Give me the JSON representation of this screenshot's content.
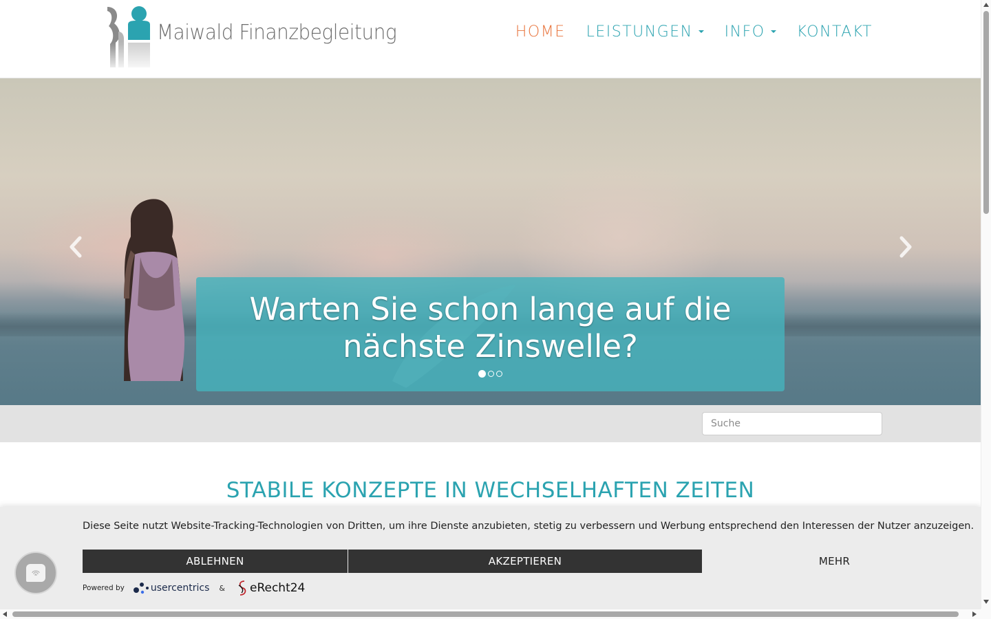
{
  "header": {
    "logo_text": "Maiwald Finanzbegleitung",
    "nav": [
      {
        "label": "HOME",
        "active": true
      },
      {
        "label": "LEISTUNGEN",
        "dropdown": true
      },
      {
        "label": "INFO",
        "dropdown": true
      },
      {
        "label": "KONTAKT"
      }
    ]
  },
  "hero": {
    "caption_line1": "Warten Sie schon lange auf die",
    "caption_line2": "nächste Zinswelle?",
    "slides_total": 3,
    "active_slide": 1,
    "prev_icon": "chevron-left-icon",
    "next_icon": "chevron-right-icon"
  },
  "search": {
    "placeholder": "Suche"
  },
  "main": {
    "headline": "STABILE KONZEPTE IN WECHSELHAFTEN ZEITEN"
  },
  "cookie_banner": {
    "text": "Diese Seite nutzt Website-Tracking-Technologien von Dritten, um ihre Dienste anzubieten, stetig zu verbessern und Werbung entsprechend den Interessen der Nutzer anzuzeigen.",
    "decline_label": "ABLEHNEN",
    "accept_label": "AKZEPTIEREN",
    "more_label": "MEHR",
    "powered_by": "Powered by",
    "provider1": "usercentrics",
    "ampersand": "&",
    "provider2": "eRecht24"
  },
  "colors": {
    "accent_teal": "#2ba3b0",
    "active_orange": "#e8733b",
    "button_dark": "#333333",
    "caption_bg": "#45b2bc"
  }
}
